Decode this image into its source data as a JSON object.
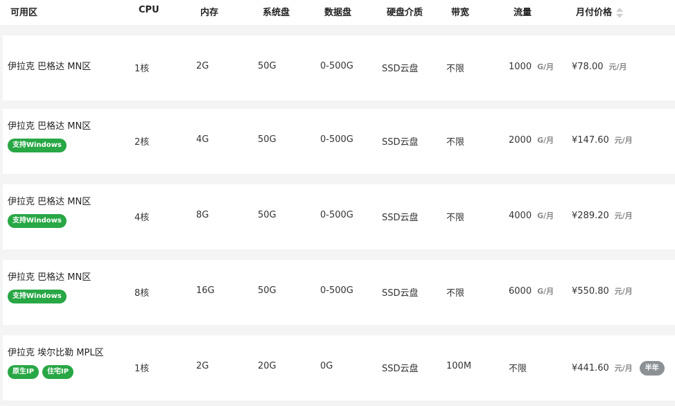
{
  "header": {
    "region": "可用区",
    "cpu": "CPU",
    "memory": "内存",
    "system_disk": "系统盘",
    "data_disk": "数据盘",
    "disk_media": "硬盘介质",
    "bandwidth": "带宽",
    "traffic": "流量",
    "monthly_price": "月付价格"
  },
  "rows": [
    {
      "region": "伊拉克 巴格达 MN区",
      "tags": [],
      "cpu": "1核",
      "memory": "2G",
      "system_disk": "50G",
      "data_disk": "0-500G",
      "disk_media": "SSD云盘",
      "bandwidth": "不限",
      "traffic": "1000",
      "traffic_unit": "G/月",
      "price": "¥78.00",
      "price_unit": "元/月",
      "badge": ""
    },
    {
      "region": "伊拉克 巴格达 MN区",
      "tags": [
        "支持Windows"
      ],
      "cpu": "2核",
      "memory": "4G",
      "system_disk": "50G",
      "data_disk": "0-500G",
      "disk_media": "SSD云盘",
      "bandwidth": "不限",
      "traffic": "2000",
      "traffic_unit": "G/月",
      "price": "¥147.60",
      "price_unit": "元/月",
      "badge": ""
    },
    {
      "region": "伊拉克 巴格达 MN区",
      "tags": [
        "支持Windows"
      ],
      "cpu": "4核",
      "memory": "8G",
      "system_disk": "50G",
      "data_disk": "0-500G",
      "disk_media": "SSD云盘",
      "bandwidth": "不限",
      "traffic": "4000",
      "traffic_unit": "G/月",
      "price": "¥289.20",
      "price_unit": "元/月",
      "badge": ""
    },
    {
      "region": "伊拉克 巴格达 MN区",
      "tags": [
        "支持Windows"
      ],
      "cpu": "8核",
      "memory": "16G",
      "system_disk": "50G",
      "data_disk": "0-500G",
      "disk_media": "SSD云盘",
      "bandwidth": "不限",
      "traffic": "6000",
      "traffic_unit": "G/月",
      "price": "¥550.80",
      "price_unit": "元/月",
      "badge": ""
    },
    {
      "region": "伊拉克 埃尔比勒 MPL区",
      "tags": [
        "原生IP",
        "住宅IP"
      ],
      "cpu": "1核",
      "memory": "2G",
      "system_disk": "20G",
      "data_disk": "0G",
      "disk_media": "SSD云盘",
      "bandwidth": "100M",
      "traffic": "不限",
      "traffic_unit": "",
      "price": "¥441.60",
      "price_unit": "元/月",
      "badge": "半年"
    }
  ],
  "icons": {
    "sort": "sort-caret-icon"
  },
  "colors": {
    "tag_green": "#28a745",
    "badge_gray": "#8c9196",
    "unit_gray": "#888888"
  }
}
